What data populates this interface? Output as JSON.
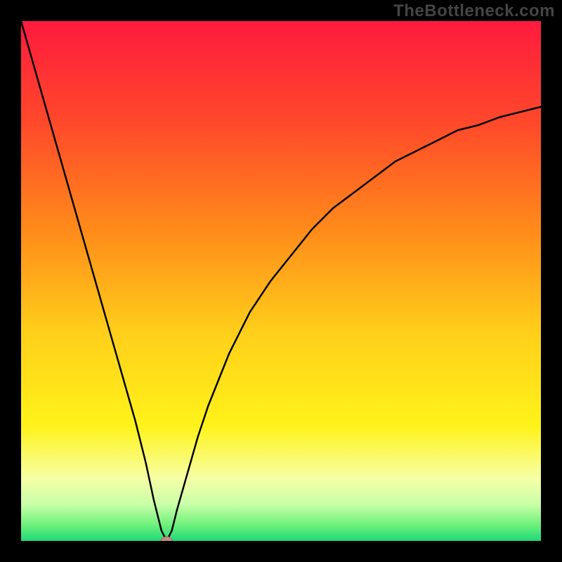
{
  "watermark_text": "TheBottleneck.com",
  "colors": {
    "frame_bg": "#000000",
    "watermark": "#444444",
    "gradient_stops": [
      {
        "offset": 0.0,
        "color": "#ff1a3e"
      },
      {
        "offset": 0.2,
        "color": "#ff4a2a"
      },
      {
        "offset": 0.4,
        "color": "#ff8a1a"
      },
      {
        "offset": 0.6,
        "color": "#ffcf1a"
      },
      {
        "offset": 0.78,
        "color": "#fff31a"
      },
      {
        "offset": 0.88,
        "color": "#f6ffa6"
      },
      {
        "offset": 0.93,
        "color": "#c8ffa8"
      },
      {
        "offset": 0.97,
        "color": "#6cf07a"
      },
      {
        "offset": 1.0,
        "color": "#1ed87a"
      }
    ],
    "curve": "#000000",
    "marker_fill": "#c58b7d",
    "marker_stroke": "#9a6a5e"
  },
  "chart_data": {
    "type": "line",
    "title": "",
    "xlabel": "",
    "ylabel": "",
    "xlim": [
      0,
      100
    ],
    "ylim": [
      0,
      100
    ],
    "grid": false,
    "legend_position": "none",
    "series": [
      {
        "name": "bottleneck-curve",
        "x": [
          0,
          2,
          4,
          6,
          8,
          10,
          12,
          14,
          16,
          18,
          20,
          22,
          24,
          25.5,
          27,
          28,
          29,
          30,
          32,
          34,
          36,
          38,
          40,
          44,
          48,
          52,
          56,
          60,
          64,
          68,
          72,
          76,
          80,
          84,
          88,
          92,
          96,
          100
        ],
        "y": [
          100,
          93,
          86,
          79,
          72,
          65,
          58,
          51,
          44,
          37,
          30,
          23,
          15,
          8,
          2,
          0,
          2,
          6,
          13,
          20,
          26,
          31,
          36,
          44,
          50,
          55,
          60,
          64,
          67,
          70,
          73,
          75,
          77,
          79,
          80,
          81.5,
          82.5,
          83.5
        ]
      }
    ],
    "annotations": [
      {
        "name": "optimal-point",
        "x": 28,
        "y": 0,
        "shape": "ellipse"
      }
    ]
  }
}
